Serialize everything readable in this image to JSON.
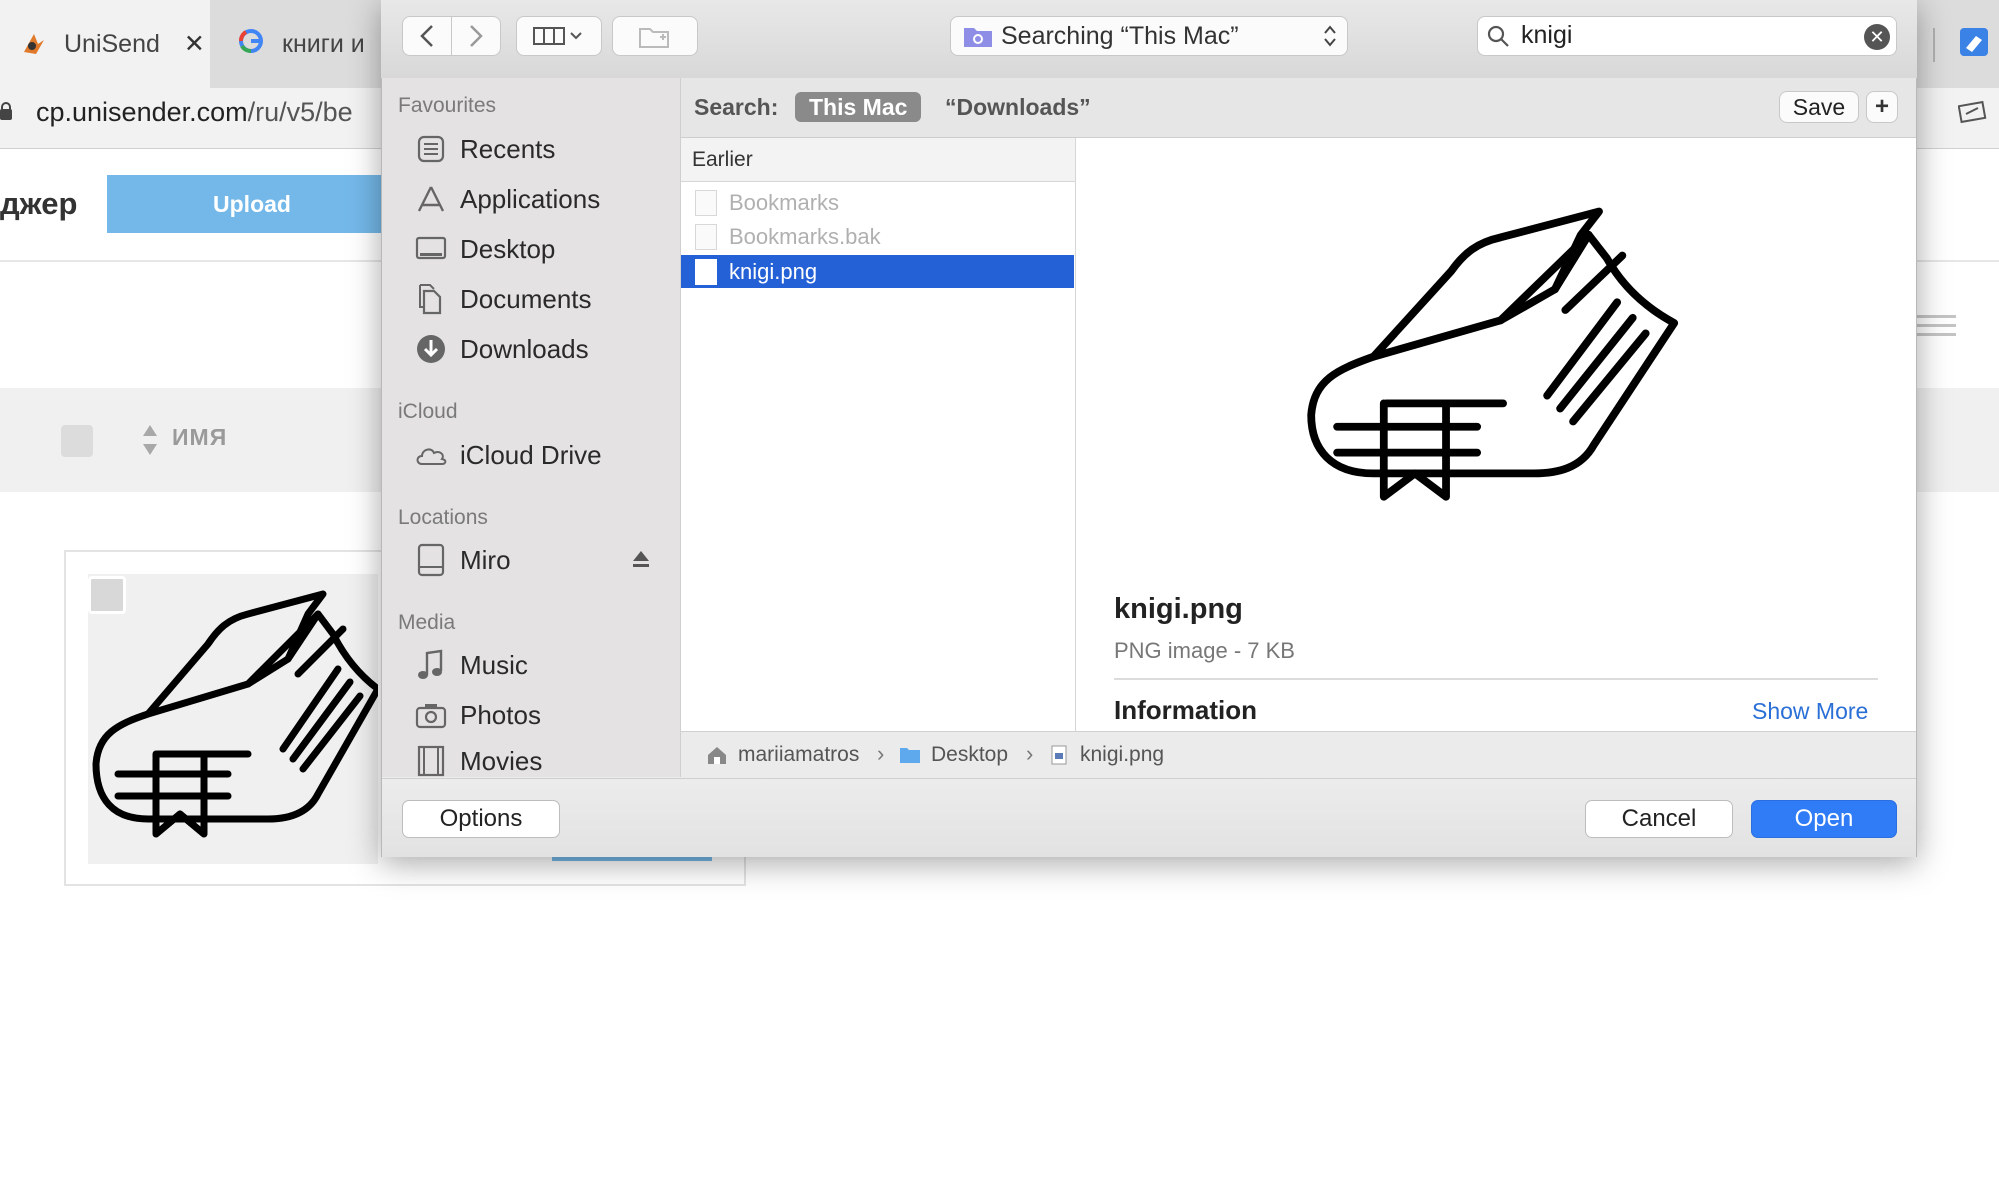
{
  "browser": {
    "tabs": [
      {
        "label": "UniSend",
        "close": "✕"
      },
      {
        "label": "книги и"
      }
    ],
    "url_host": "cp.unisender.com",
    "url_path": "/ru/v5/be"
  },
  "page": {
    "title": "джер",
    "upload_label": "Upload",
    "column_name": "ИМЯ"
  },
  "dialog": {
    "location": "Searching “This Mac”",
    "search_value": "knigi",
    "sidebar": {
      "favourites_heading": "Favourites",
      "favourites": [
        "Recents",
        "Applications",
        "Desktop",
        "Documents",
        "Downloads"
      ],
      "icloud_heading": "iCloud",
      "icloud": [
        "iCloud Drive"
      ],
      "locations_heading": "Locations",
      "locations": [
        "Miro"
      ],
      "media_heading": "Media",
      "media": [
        "Music",
        "Photos",
        "Movies"
      ]
    },
    "scope": {
      "label": "Search:",
      "this_mac": "This Mac",
      "downloads": "“Downloads”",
      "save": "Save",
      "add": "+"
    },
    "list": {
      "group": "Earlier",
      "files": [
        "Bookmarks",
        "Bookmarks.bak",
        "knigi.png"
      ],
      "selected": "knigi.png"
    },
    "preview": {
      "name": "knigi.png",
      "kind": "PNG image - 7 KB",
      "info_label": "Information",
      "show_more": "Show More"
    },
    "path": [
      "mariiamatros",
      "Desktop",
      "knigi.png"
    ],
    "buttons": {
      "options": "Options",
      "cancel": "Cancel",
      "open": "Open"
    }
  },
  "colors": {
    "accent": "#2f7cf6",
    "selection": "#2461d6",
    "upload": "#74b8e9"
  }
}
